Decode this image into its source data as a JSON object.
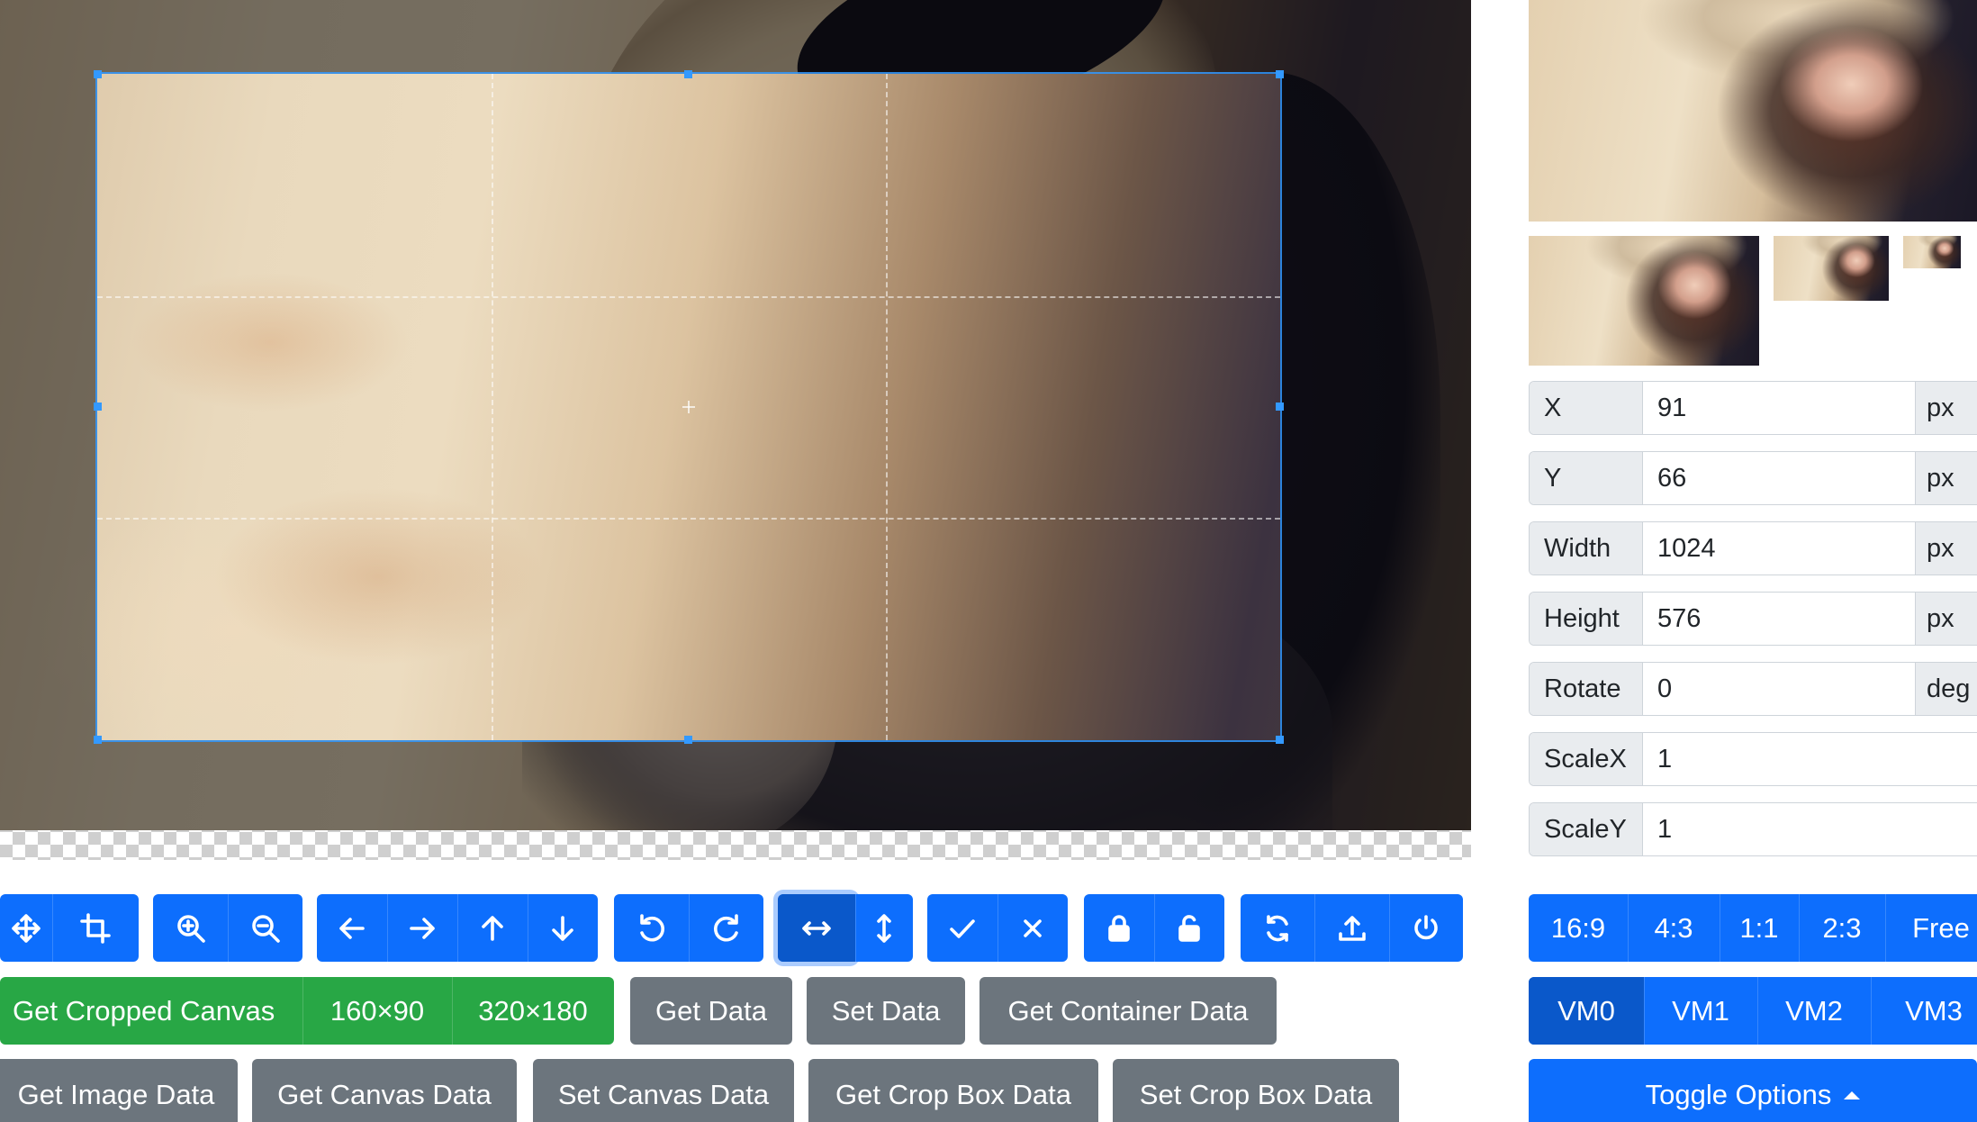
{
  "toolbar": {
    "mode_group": [
      "move-icon",
      "crop-icon"
    ],
    "zoom_group": [
      "zoom-in-icon",
      "zoom-out-icon"
    ],
    "move_group": [
      "arrow-left-icon",
      "arrow-right-icon",
      "arrow-up-icon",
      "arrow-down-icon"
    ],
    "rotate_group": [
      "rotate-left-icon",
      "rotate-right-icon"
    ],
    "flip_group": [
      "flip-horizontal-icon",
      "flip-vertical-icon"
    ],
    "crop_group": [
      "check-icon",
      "close-icon"
    ],
    "lock_group": [
      "lock-icon",
      "unlock-icon"
    ],
    "misc_group": [
      "refresh-icon",
      "upload-icon",
      "power-icon"
    ]
  },
  "actions": {
    "get_cropped_canvas": "Get Cropped Canvas",
    "size_160": "160×90",
    "size_320": "320×180",
    "get_data": "Get Data",
    "set_data": "Set Data",
    "get_container_data": "Get Container Data",
    "get_image_data": "Get Image Data",
    "get_canvas_data": "Get Canvas Data",
    "set_canvas_data": "Set Canvas Data",
    "get_crop_box_data": "Get Crop Box Data",
    "set_crop_box_data": "Set Crop Box Data"
  },
  "form": {
    "x": {
      "label": "X",
      "value": "91",
      "unit": "px"
    },
    "y": {
      "label": "Y",
      "value": "66",
      "unit": "px"
    },
    "width": {
      "label": "Width",
      "value": "1024",
      "unit": "px"
    },
    "height": {
      "label": "Height",
      "value": "576",
      "unit": "px"
    },
    "rotate": {
      "label": "Rotate",
      "value": "0",
      "unit": "deg"
    },
    "scale_x": {
      "label": "ScaleX",
      "value": "1"
    },
    "scale_y": {
      "label": "ScaleY",
      "value": "1"
    }
  },
  "aspect_ratios": [
    "16:9",
    "4:3",
    "1:1",
    "2:3",
    "Free"
  ],
  "view_modes": [
    "VM0",
    "VM1",
    "VM2",
    "VM3"
  ],
  "toggle_options": "Toggle Options",
  "colors": {
    "primary": "#0d6efd",
    "primary_active": "#0a58ca",
    "success": "#28a745",
    "secondary": "#6c757d",
    "crop_outline": "#3399ff"
  }
}
